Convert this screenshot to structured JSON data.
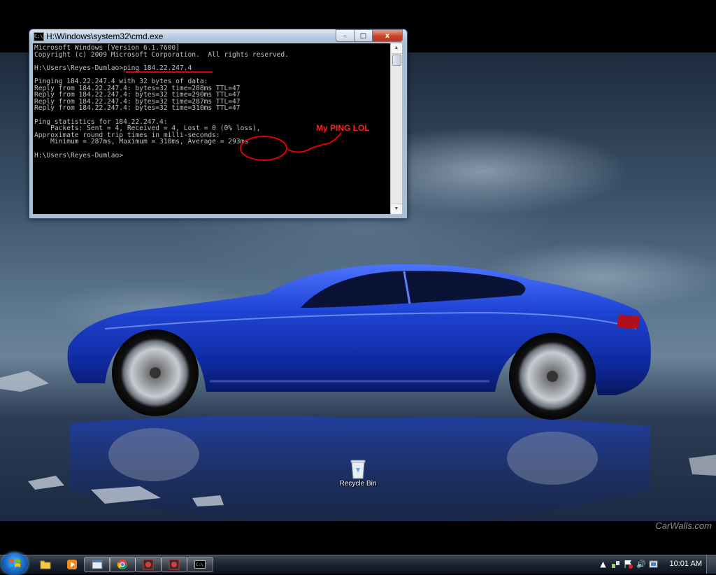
{
  "cmd": {
    "title": "H:\\Windows\\system32\\cmd.exe",
    "icon_text": "C:\\",
    "lines": [
      "Microsoft Windows [Version 6.1.7600]",
      "Copyright (c) 2009 Microsoft Corporation.  All rights reserved.",
      "",
      "H:\\Users\\Reyes-Dumlao>ping 184.22.247.4",
      "",
      "Pinging 184.22.247.4 with 32 bytes of data:",
      "Reply from 184.22.247.4: bytes=32 time=288ms TTL=47",
      "Reply from 184.22.247.4: bytes=32 time=290ms TTL=47",
      "Reply from 184.22.247.4: bytes=32 time=287ms TTL=47",
      "Reply from 184.22.247.4: bytes=32 time=310ms TTL=47",
      "",
      "Ping statistics for 184.22.247.4:",
      "    Packets: Sent = 4, Received = 4, Lost = 0 (0% loss),",
      "Approximate round trip times in milli-seconds:",
      "    Minimum = 287ms, Maximum = 310ms, Average = 293ms",
      "",
      "H:\\Users\\Reyes-Dumlao>"
    ],
    "minimize_glyph": "–",
    "maximize_glyph": "□",
    "close_glyph": "x",
    "scroll_up_glyph": "▲",
    "scroll_down_glyph": "▼"
  },
  "annotation": {
    "label": "My PING LOL",
    "color": "#e00000"
  },
  "desktop": {
    "recycle_bin_label": "Recycle Bin",
    "watermark": "CarWalls.com"
  },
  "taskbar": {
    "pinned": [
      {
        "name": "explorer-icon"
      },
      {
        "name": "media-player-icon"
      },
      {
        "name": "window-icon"
      },
      {
        "name": "chrome-icon"
      },
      {
        "name": "media-app-icon"
      },
      {
        "name": "media-app-icon"
      },
      {
        "name": "cmd-icon"
      }
    ],
    "clock": "10:01 AM",
    "tray": {
      "arrow": "▲",
      "volume": "🔊"
    }
  },
  "colors": {
    "car_blue": "#1a3fcf",
    "cmd_background": "#000000",
    "cmd_text": "#c0c0c0"
  }
}
